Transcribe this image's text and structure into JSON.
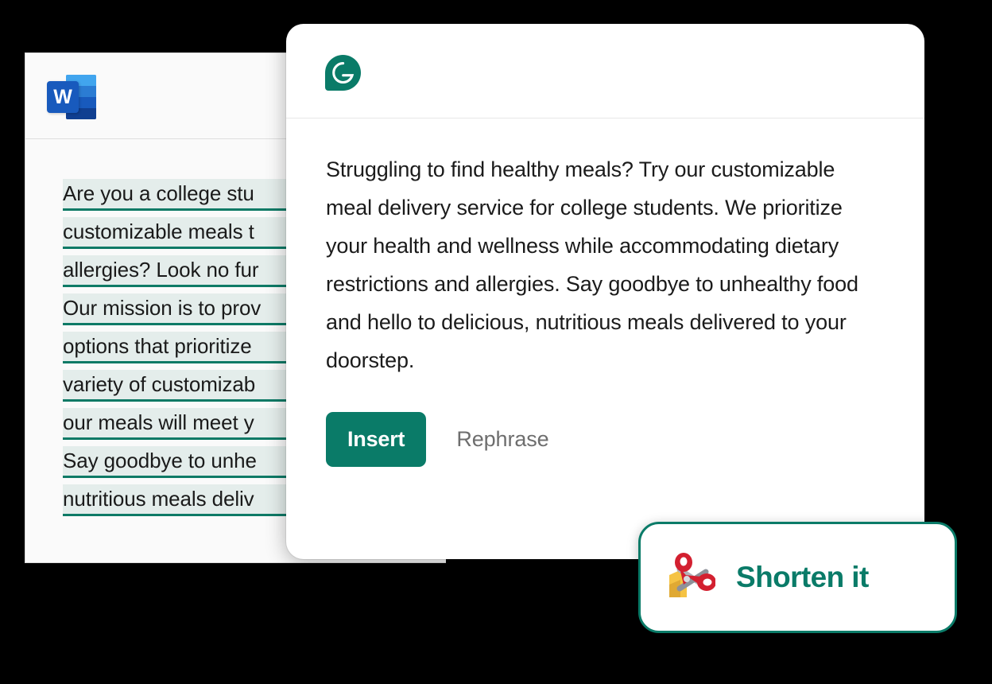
{
  "colors": {
    "background": "#000000",
    "brand_teal": "#0a7b68",
    "highlight_green": "#e4edeb",
    "underline_teal": "#0e7a66",
    "word_blue": "#185abd",
    "scissors_red": "#d32030",
    "paper_yellow": "#f5c344"
  },
  "word_window": {
    "app_icon_label": "W",
    "app_icon_name": "microsoft-word-icon",
    "document_lines": [
      "Are you a college stu",
      "customizable meals t",
      "allergies? Look no fur",
      "Our mission is to prov",
      "options that prioritize",
      "variety of customizab",
      "our meals will meet y",
      "Say goodbye to unhe",
      "nutritious meals deliv"
    ]
  },
  "grammarly_card": {
    "logo_name": "grammarly-logo",
    "suggestion": "Struggling to find healthy meals? Try our customizable meal delivery service for college students. We prioritize your health and wellness while accommodating dietary restrictions and allergies. Say goodbye to unhealthy food and hello to delicious, nutritious meals delivered to your doorstep.",
    "actions": {
      "insert_label": "Insert",
      "rephrase_label": "Rephrase"
    }
  },
  "shorten_card": {
    "icon_name": "scissors-icon",
    "label": "Shorten it"
  }
}
